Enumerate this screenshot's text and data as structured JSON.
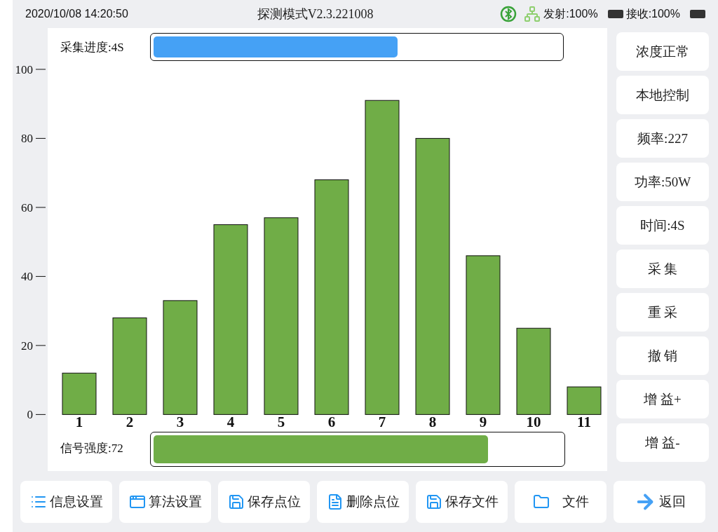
{
  "status_bar": {
    "datetime": "2020/10/08 14:20:50",
    "title": "探测模式V2.3.221008",
    "transmit": "发射:100%",
    "receive": "接收:100%"
  },
  "progress": {
    "label": "采集进度:4S",
    "level": 0.6
  },
  "signal": {
    "label": "信号强度:72",
    "level": 0.82
  },
  "chart_data": {
    "type": "bar",
    "categories": [
      "1",
      "2",
      "3",
      "4",
      "5",
      "6",
      "7",
      "8",
      "9",
      "10",
      "11"
    ],
    "series": [
      {
        "color": "#70ad47",
        "values": [
          12,
          28,
          33,
          55,
          57,
          68,
          91,
          80,
          46,
          25,
          8
        ]
      }
    ],
    "ylim": [
      -5,
      101
    ],
    "yticks": [
      0,
      20,
      40,
      60,
      80,
      100
    ]
  },
  "side_buttons": [
    "浓度正常",
    "本地控制",
    "频率:227",
    "功率:50W",
    "时间:4S",
    "采 集",
    "重 采",
    "撤 销",
    "增 益+",
    "增 益-"
  ],
  "bottom_buttons": [
    "信息设置",
    "算法设置",
    "保存点位",
    "删除点位",
    "保存文件",
    "文件"
  ],
  "back_button": "返回"
}
